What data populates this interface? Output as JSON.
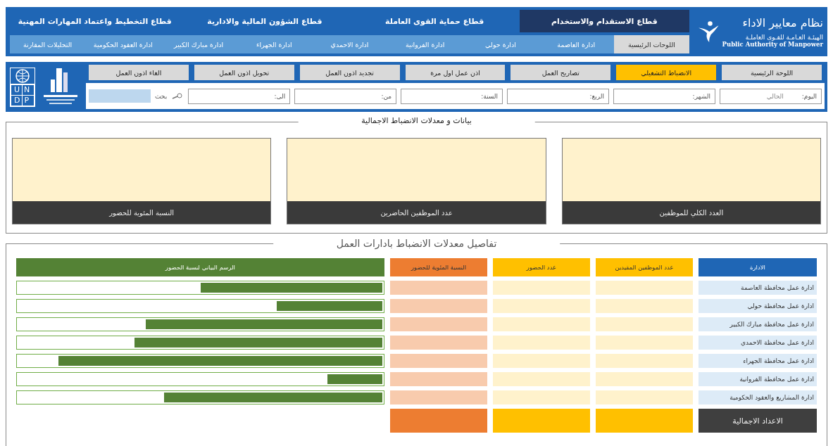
{
  "header": {
    "system_title": "نظام معايير الاداء",
    "authority_ar": "الهيئـة العـامـة للقـوى العاملـة",
    "authority_en": "Public Authority of Manpower",
    "sectors": [
      {
        "label": "قطاع الاستقدام والاستخدام",
        "selected": true
      },
      {
        "label": "قطاع حماية القوى العاملة",
        "selected": false
      },
      {
        "label": "قطاع الشؤون المالية والادارية",
        "selected": false
      },
      {
        "label": "قطاع التخطيط واعتماد المهارات المهنية",
        "selected": false
      }
    ],
    "departments": [
      {
        "label": "اللوحات الرئيسية",
        "selected": true
      },
      {
        "label": "ادارة  العاصمة",
        "selected": false
      },
      {
        "label": "ادارة  حولي",
        "selected": false
      },
      {
        "label": "ادارة الفروانية",
        "selected": false
      },
      {
        "label": "ادارة الاحمدي",
        "selected": false
      },
      {
        "label": "ادارة الجهراء",
        "selected": false
      },
      {
        "label": "ادارة مبارك الكبير",
        "selected": false
      },
      {
        "label": "ادارة العقود الحكومية",
        "selected": false
      },
      {
        "label": "التحليلات المقارنة",
        "selected": false
      }
    ]
  },
  "toolbar": {
    "undp_rows": [
      "UN",
      "DP"
    ],
    "pages": [
      {
        "label": "اللوحة الرئيسية",
        "selected": false
      },
      {
        "label": "الانضباط التشغيلي",
        "selected": true
      },
      {
        "label": "تصاريح العمل",
        "selected": false
      },
      {
        "label": "اذن عمل اول مرة",
        "selected": false
      },
      {
        "label": "تجديد اذون العمل",
        "selected": false
      },
      {
        "label": "تحويل اذون العمل",
        "selected": false
      },
      {
        "label": "الغاء اذون العمل",
        "selected": false
      }
    ],
    "filters": [
      {
        "label": "اليوم:",
        "value": "الحالي"
      },
      {
        "label": "الشهر:"
      },
      {
        "label": "الربع:"
      },
      {
        "label": "السنة:"
      },
      {
        "label": "من:"
      },
      {
        "label": "الى:"
      }
    ],
    "search_label": "بحث"
  },
  "summary": {
    "title": "بيانات و معدلات الانضباط الاجمالية",
    "cards": [
      "العدد الكلي للموظفين",
      "عدد الموظفين الحاضرين",
      "النسبة المئوية للحضور"
    ]
  },
  "details": {
    "title": "تفاصيل معدلات الانضباط بادارات العمل",
    "columns": [
      "الادارة",
      "عدد الموظفين المقيدين",
      "عدد الحضور",
      "النسبة المئوية للحضور",
      "الرسم البياني لنسبة الحضور"
    ],
    "rows": [
      {
        "name": "ادارة عمل محافظة العاصمة",
        "level": 0.5
      },
      {
        "name": "ادارة عمل محافظة حولي",
        "level": 0.29
      },
      {
        "name": "ادارة عمل محافظة مبارك الكبير",
        "level": 0.65
      },
      {
        "name": "ادارة عمل محافظة الاحمدي",
        "level": 0.68
      },
      {
        "name": "ادارة عمل محافظة الجهراء",
        "level": 0.89
      },
      {
        "name": "ادارة عمل محافظة الفروانية",
        "level": 0.15
      },
      {
        "name": "ادارة المشاريع والعقود الحكومية",
        "level": 0.6
      }
    ],
    "total_label": "الاعداد الاجمالية"
  }
}
